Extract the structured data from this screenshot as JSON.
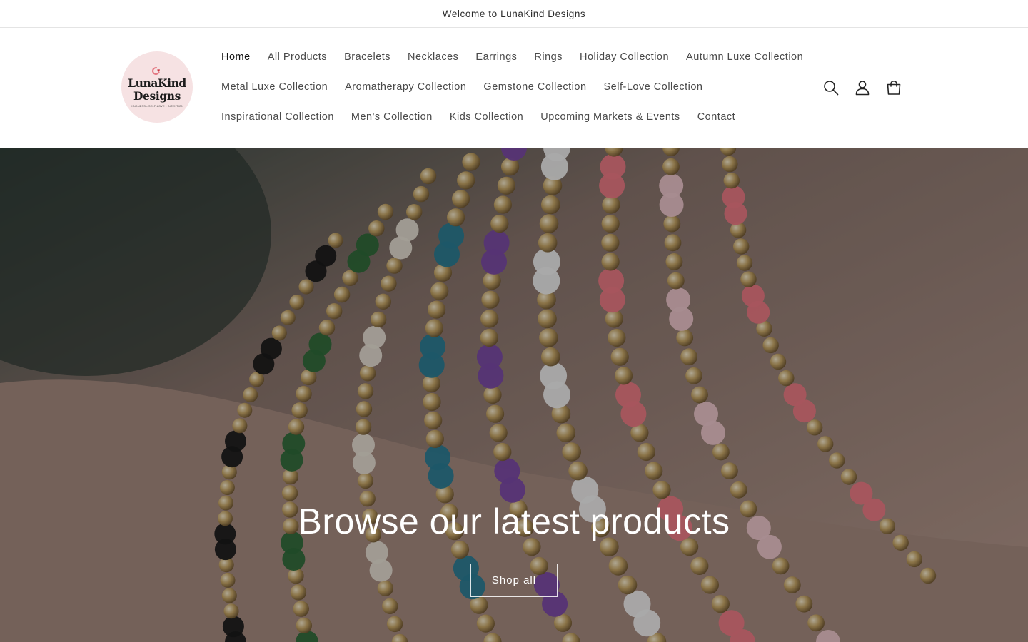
{
  "announcement": {
    "text": "Welcome to LunaKind Designs"
  },
  "logo": {
    "line1": "LunaKind",
    "line2": "Designs",
    "tagline": "Kindness • Self-Love • Intention",
    "background": "#f6e2e3",
    "accent": "#e47a84"
  },
  "nav": {
    "rows": [
      [
        {
          "label": "Home",
          "active": true
        },
        {
          "label": "All Products"
        },
        {
          "label": "Bracelets"
        },
        {
          "label": "Necklaces"
        },
        {
          "label": "Earrings"
        },
        {
          "label": "Rings"
        },
        {
          "label": "Holiday Collection"
        },
        {
          "label": "Autumn Luxe Collection"
        }
      ],
      [
        {
          "label": "Metal Luxe Collection"
        },
        {
          "label": "Aromatherapy Collection"
        },
        {
          "label": "Gemstone Collection"
        },
        {
          "label": "Self-Love Collection"
        }
      ],
      [
        {
          "label": "Inspirational Collection"
        },
        {
          "label": "Men's Collection"
        },
        {
          "label": "Kids Collection"
        },
        {
          "label": "Upcoming Markets & Events"
        },
        {
          "label": "Contact"
        }
      ]
    ]
  },
  "header_icons": {
    "search": "search-icon",
    "account": "account-icon",
    "cart": "cart-icon"
  },
  "hero": {
    "heading": "Browse our latest products",
    "button_label": "Shop all",
    "image": "beaded-bracelets-on-wrist"
  }
}
